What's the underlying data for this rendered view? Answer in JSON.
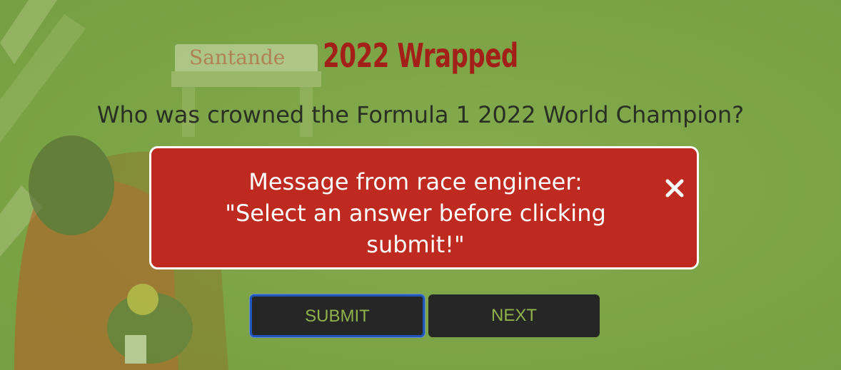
{
  "page": {
    "title": "2022 Wrapped",
    "question": "Who was crowned the Formula 1 2022 World Champion?"
  },
  "background": {
    "description_icon": "f1-car-background",
    "sponsor_text": "Santander",
    "tint_color": "#7fa64a"
  },
  "modal": {
    "lines": [
      "Message from race engineer:",
      "\"Select an answer before clicking",
      "submit!\""
    ],
    "close_icon": "close-icon",
    "background_color": "#be2a20",
    "border_color": "#ffffff"
  },
  "buttons": {
    "submit_label": "SUBMIT",
    "next_label": "NEXT",
    "text_color": "#8fb24a",
    "background_color": "#262626",
    "focus_color": "#1f56b8"
  }
}
